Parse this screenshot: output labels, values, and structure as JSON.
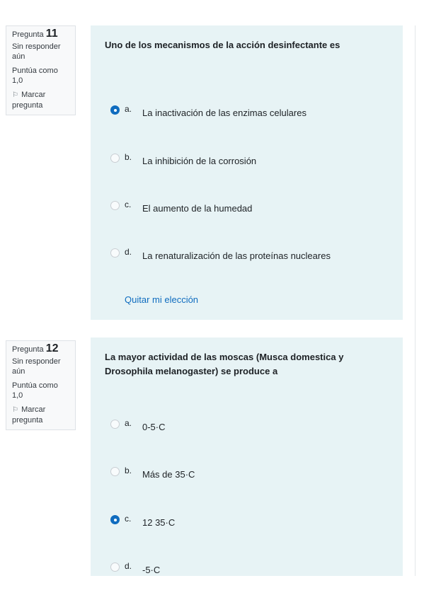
{
  "questions": [
    {
      "label": "Pregunta",
      "number": "11",
      "state": "Sin responder aún",
      "grade": "Puntúa como 1,0",
      "flag": "Marcar pregunta",
      "text": "Uno de los mecanismos de la acción desinfectante es",
      "options": [
        {
          "letter": "a.",
          "text": "La inactivación de las enzimas celulares",
          "selected": true
        },
        {
          "letter": "b.",
          "text": "La inhibición de la corrosión",
          "selected": false
        },
        {
          "letter": "c.",
          "text": "El aumento de la humedad",
          "selected": false
        },
        {
          "letter": "d.",
          "text": "La renaturalización de las proteínas nucleares",
          "selected": false
        }
      ],
      "clear": "Quitar mi elección"
    },
    {
      "label": "Pregunta",
      "number": "12",
      "state": "Sin responder aún",
      "grade": "Puntúa como 1,0",
      "flag": "Marcar pregunta",
      "text": "La mayor actividad de las moscas (Musca domestica y Drosophila melanogaster) se produce a",
      "options": [
        {
          "letter": "a.",
          "text": "0-5·C",
          "selected": false
        },
        {
          "letter": "b.",
          "text": "Más de 35·C",
          "selected": false
        },
        {
          "letter": "c.",
          "text": "12 35·C",
          "selected": true
        },
        {
          "letter": "d.",
          "text": "-5·C",
          "selected": false
        }
      ]
    }
  ],
  "colors": {
    "content_bg": "#e7f3f5",
    "accent": "#0f6cbf",
    "info_bg": "#f8f9fa"
  }
}
